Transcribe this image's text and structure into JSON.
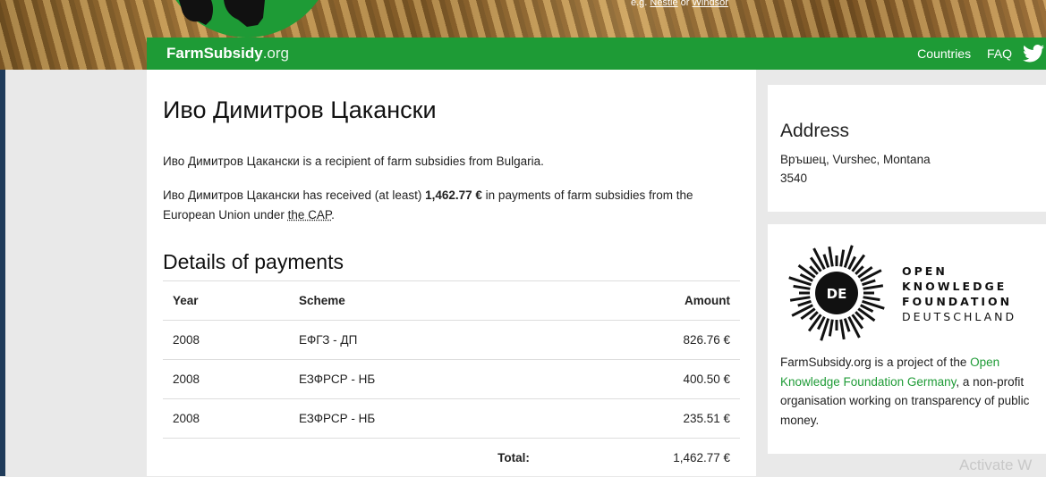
{
  "header": {
    "search_hint_prefix": "e.g.",
    "search_hint_link1": "Nestle",
    "search_hint_sep": "or",
    "search_hint_link2": "Windsor",
    "brand_main": "FarmSubsidy",
    "brand_tld": ".org",
    "nav": {
      "countries": "Countries",
      "faq": "FAQ"
    },
    "colors": {
      "brand_green": "#1e9b36"
    }
  },
  "main": {
    "title": "Иво Димитров Цакански",
    "intro": "Иво Димитров Цакански is a recipient of farm subsidies from Bulgaria.",
    "received_prefix": "Иво Димитров Цакански has received (at least)",
    "received_amount": "1,462.77 €",
    "received_middle": "in payments of farm subsidies from the European Union under",
    "cap_link": "the CAP",
    "received_end": ".",
    "details_heading": "Details of payments",
    "table": {
      "headers": {
        "year": "Year",
        "scheme": "Scheme",
        "amount": "Amount"
      },
      "rows": [
        {
          "year": "2008",
          "scheme": "ЕФГЗ - ДП",
          "amount": "826.76 €"
        },
        {
          "year": "2008",
          "scheme": "ЕЗФРСР - НБ",
          "amount": "400.50 €"
        },
        {
          "year": "2008",
          "scheme": "ЕЗФРСР - НБ",
          "amount": "235.51 €"
        }
      ],
      "total_label": "Total:",
      "total_value": "1,462.77 €"
    }
  },
  "sidebar": {
    "address_heading": "Address",
    "address_line1": "Връшец, Vurshec, Montana",
    "address_line2": "3540",
    "okf": {
      "logo_badge": "DE",
      "logo_line1": "OPEN",
      "logo_line2": "KNOWLEDGE",
      "logo_line3": "FOUNDATION",
      "logo_line4": "DEUTSCHLAND",
      "desc_prefix": "FarmSubsidy.org is a project of the",
      "desc_link": "Open Knowledge Foundation Germany",
      "desc_suffix": ", a non-profit organisation working on transparency of public money."
    }
  },
  "watermark": "Activate W"
}
